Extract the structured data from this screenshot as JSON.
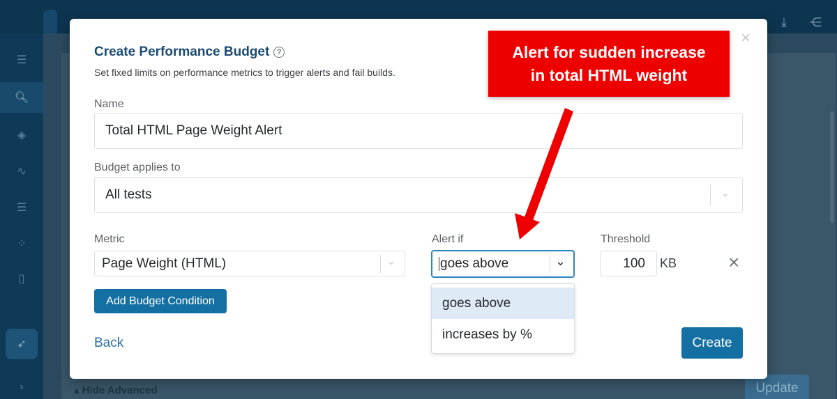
{
  "modal": {
    "title": "Create Performance Budget",
    "help_glyph": "?",
    "subtitle": "Set fixed limits on performance metrics to trigger alerts and fail builds.",
    "close_glyph": "×",
    "name_label": "Name",
    "name_value": "Total HTML Page Weight Alert",
    "applies_label": "Budget applies to",
    "applies_value": "All tests",
    "metric_label": "Metric",
    "metric_value": "Page Weight (HTML)",
    "alertif_label": "Alert if",
    "alertif_value": "goes above",
    "threshold_label": "Threshold",
    "threshold_value": "100",
    "threshold_unit": "KB",
    "remove_glyph": "×",
    "add_condition_label": "Add Budget Condition",
    "back_label": "Back",
    "create_label": "Create"
  },
  "alertif_options": [
    "goes above",
    "increases by %"
  ],
  "alertif_selected_index": 0,
  "background": {
    "hide_advanced": "▴ Hide Advanced",
    "update_label": "Update"
  },
  "annotation": {
    "line1": "Alert for sudden increase",
    "line2": "in total HTML weight"
  },
  "colors": {
    "accent": "#146fa3",
    "focus_border": "#2a86bd",
    "annotation": "#ee0000"
  },
  "icons": [
    "help-icon",
    "close-icon",
    "chevron-down-icon",
    "download-icon",
    "share-icon",
    "rocket-icon"
  ]
}
